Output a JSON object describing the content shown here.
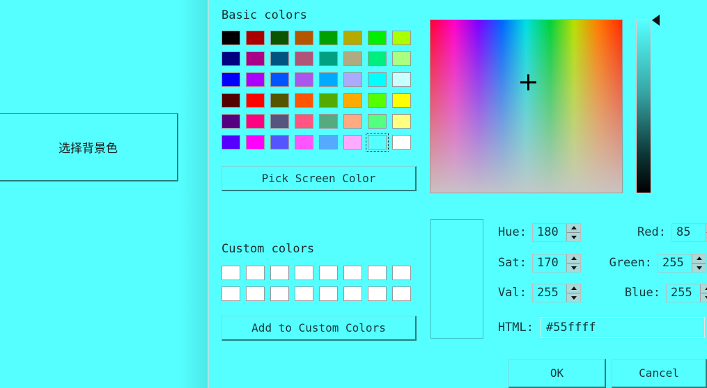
{
  "host_window": {
    "background_color": "#55ffff",
    "select_background_color_button": "选择背景色"
  },
  "dialog": {
    "background_color": "#55ffff",
    "basic_colors_label": "Basic colors",
    "custom_colors_label": "Custom colors",
    "pick_screen_color_button": "Pick Screen Color",
    "add_to_custom_colors_button": "Add to Custom Colors",
    "ok_button": "OK",
    "cancel_button": "Cancel",
    "basic_colors": [
      [
        "#000000",
        "#aa0000",
        "#0b5500",
        "#b45500",
        "#00a000",
        "#b4aa00",
        "#00ee00",
        "#aaff00"
      ],
      [
        "#000080",
        "#aa0088",
        "#005580",
        "#b05577",
        "#00a080",
        "#b0aa80",
        "#00ee80",
        "#aaff80"
      ],
      [
        "#0000ff",
        "#aa00ff",
        "#0055ff",
        "#aa55ee",
        "#00aaff",
        "#aaaaff",
        "#00ffff",
        "#c8ffff"
      ],
      [
        "#550000",
        "#ff0000",
        "#555500",
        "#ff5500",
        "#55aa00",
        "#ffaa00",
        "#55ff00",
        "#ffff00"
      ],
      [
        "#550080",
        "#ff0080",
        "#555580",
        "#ff5580",
        "#55aa80",
        "#ffaa80",
        "#55ff80",
        "#ffff80"
      ],
      [
        "#5500ff",
        "#ff00ff",
        "#5555ff",
        "#ff55ff",
        "#55aaff",
        "#ffaaff",
        "#55ffff",
        "#ffffff"
      ]
    ],
    "selected_basic_color": {
      "row": 5,
      "col": 6,
      "hex": "#55ffff"
    },
    "custom_colors": [
      [
        "#ffffff",
        "#ffffff",
        "#ffffff",
        "#ffffff",
        "#ffffff",
        "#ffffff",
        "#ffffff",
        "#ffffff"
      ],
      [
        "#ffffff",
        "#ffffff",
        "#ffffff",
        "#ffffff",
        "#ffffff",
        "#ffffff",
        "#ffffff",
        "#ffffff"
      ]
    ],
    "preview_color": "#55ffff",
    "value_slider": {
      "top_color": "#55ffff",
      "bottom_color": "#000000",
      "marker_position": "top"
    },
    "fields": {
      "hue": {
        "label": "Hue:",
        "value": "180"
      },
      "sat": {
        "label": "Sat:",
        "value": "170"
      },
      "val": {
        "label": "Val:",
        "value": "255"
      },
      "red": {
        "label": "Red:",
        "value": "85"
      },
      "green": {
        "label": "Green:",
        "value": "255"
      },
      "blue": {
        "label": "Blue:",
        "value": "255"
      },
      "html": {
        "label": "HTML:",
        "value": "#55ffff"
      }
    }
  }
}
